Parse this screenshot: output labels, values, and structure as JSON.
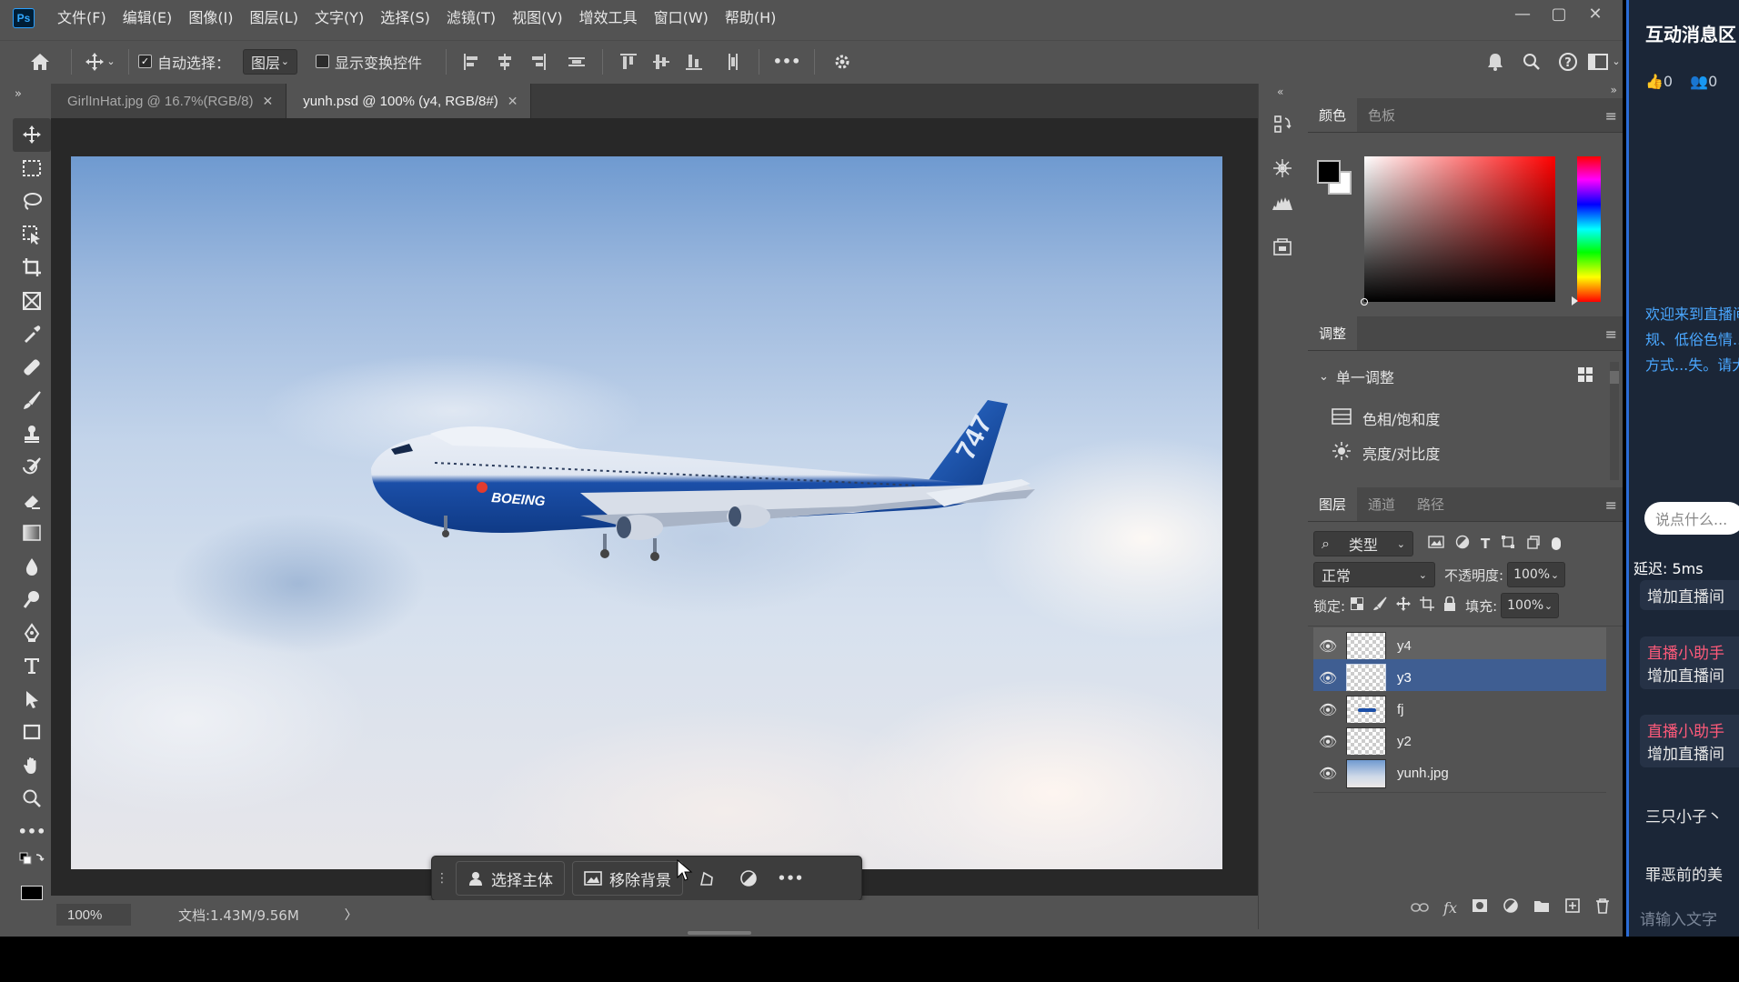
{
  "app": {
    "logo": "Ps"
  },
  "menu": [
    "文件(F)",
    "编辑(E)",
    "图像(I)",
    "图层(L)",
    "文字(Y)",
    "选择(S)",
    "滤镜(T)",
    "视图(V)",
    "增效工具",
    "窗口(W)",
    "帮助(H)"
  ],
  "window_controls": {
    "minimize": "—",
    "restore": "▢",
    "close": "✕"
  },
  "options": {
    "auto_select_label": "自动选择：",
    "auto_select_checked": true,
    "auto_select_target": "图层",
    "show_transform_label": "显示变换控件",
    "show_transform_checked": false,
    "more": "•••"
  },
  "tabs": [
    {
      "label": "GirlInHat.jpg @ 16.7%(RGB/8)",
      "active": false
    },
    {
      "label": "yunh.psd @ 100% (y4, RGB/8#)",
      "active": true
    }
  ],
  "tools": [
    "move",
    "marquee",
    "lasso",
    "object-select",
    "crop",
    "frame",
    "eyedropper",
    "healing",
    "brush",
    "stamp",
    "history-brush",
    "eraser",
    "gradient",
    "blur",
    "dodge",
    "pen",
    "type",
    "path-select",
    "rectangle",
    "hand",
    "zoom",
    "more"
  ],
  "floating_bar": {
    "select_subject": "选择主体",
    "remove_background": "移除背景",
    "more": "•••"
  },
  "status": {
    "zoom": "100%",
    "doc": "文档:1.43M/9.56M",
    "arrow": "〉"
  },
  "color_panel": {
    "tabs": [
      "颜色",
      "色板"
    ],
    "foreground": "#000000",
    "background": "#ffffff"
  },
  "adjust_panel": {
    "title": "调整",
    "group": "单一调整",
    "items": [
      "色相/饱和度",
      "亮度/对比度"
    ]
  },
  "layers_panel": {
    "tabs": [
      "图层",
      "通道",
      "路径"
    ],
    "filter_kind": "类型",
    "blend_mode": "正常",
    "opacity_label": "不透明度:",
    "opacity_value": "100%",
    "lock_label": "锁定:",
    "fill_label": "填充:",
    "fill_value": "100%",
    "layers": [
      {
        "name": "y4",
        "visible": true,
        "state": "hover"
      },
      {
        "name": "y3",
        "visible": true,
        "state": "selected"
      },
      {
        "name": "fj",
        "visible": true,
        "state": ""
      },
      {
        "name": "y2",
        "visible": true,
        "state": ""
      },
      {
        "name": "yunh.jpg",
        "visible": true,
        "state": ""
      }
    ]
  },
  "chat": {
    "title": "互动消息区",
    "likes": "0",
    "users": "0",
    "welcome": "欢迎来到直播间！违法违规、低俗色情...程中以不当方式...失。请大家注意...",
    "say_placeholder": "说点什么...",
    "delay": "延迟: 5ms",
    "messages": [
      {
        "name": "",
        "text": "增加直播间"
      },
      {
        "name": "直播小助手",
        "text": "增加直播间"
      },
      {
        "name": "直播小助手",
        "text": "增加直播间"
      }
    ],
    "plain1": "三只小子丶",
    "plain2": "罪恶前的美",
    "input_placeholder": "请输入文字"
  },
  "colors": {
    "accent": "#3f5e92",
    "chat_name": "#ff5a7a",
    "chat_link": "#4aa7ff",
    "airplane": "#1b4fa8"
  }
}
